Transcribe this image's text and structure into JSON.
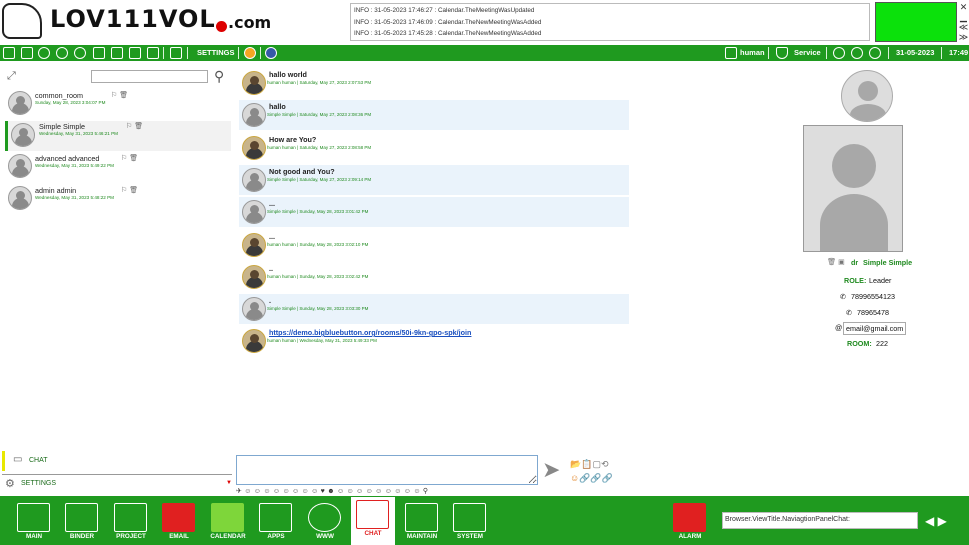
{
  "logo": {
    "text": "LOV111VOL",
    "domain": ".com"
  },
  "log": [
    "INFO : 31-05-2023 17:46:27 : Calendar.TheMeetingWasUpdated",
    "INFO : 31-05-2023 17:46:09 : Calendar.TheNewMeetingWasAdded",
    "INFO : 31-05-2023 17:45:28 : Calendar.TheNewMeetingWasAdded"
  ],
  "toolbar": {
    "settings": "SETTINGS",
    "user": "human",
    "service": "Service",
    "date": "31-05-2023",
    "time": "17:49"
  },
  "rooms": [
    {
      "name": "common_room",
      "date": "Sunday, May 28, 2023 3:04:07 PM"
    },
    {
      "name": "Simple Simple",
      "date": "Wednesday, May 31, 2023 5:46:21 PM"
    },
    {
      "name": "advanced advanced",
      "date": "Wednesday, May 31, 2023 5:49:22 PM"
    },
    {
      "name": "admin admin",
      "date": "Wednesday, May 31, 2023 5:48:22 PM"
    }
  ],
  "leftnav": {
    "chat": "CHAT",
    "settings": "SETTINGS"
  },
  "messages": [
    {
      "text": "hallo world",
      "meta": "human human | Saturday, May 27, 2023 2:07:53 PM",
      "photo": true
    },
    {
      "text": "hallo",
      "meta": "Simple Simple | Saturday, May 27, 2023 2:08:36 PM",
      "photo": false
    },
    {
      "text": "How are You?",
      "meta": "human human | Saturday, May 27, 2023 2:08:58 PM",
      "photo": true
    },
    {
      "text": "Not good and You?",
      "meta": "Simple Simple | Saturday, May 27, 2023 2:09:14 PM",
      "photo": false
    },
    {
      "text": "...",
      "meta": "Simple Simple | Sunday, May 28, 2023 3:01:42 PM",
      "photo": false
    },
    {
      "text": "...",
      "meta": "human human | Sunday, May 28, 2023 3:02:10 PM",
      "photo": true
    },
    {
      "text": "..",
      "meta": "human human | Sunday, May 28, 2023 3:02:42 PM",
      "photo": true
    },
    {
      "text": ".",
      "meta": "Simple Simple | Sunday, May 28, 2023 3:03:30 PM",
      "photo": false
    },
    {
      "text": "https://demo.bigbluebutton.org/rooms/50i-9kn-gpo-spk/join",
      "meta": "human human | Wednesday, May 31, 2023 5:49:33 PM",
      "photo": true,
      "link": true
    }
  ],
  "profile": {
    "title": "dr",
    "name": "Simple Simple",
    "role_label": "ROLE:",
    "role": "Leader",
    "phone1": "78996554123",
    "phone2": "78965478",
    "email": "email@gmail.com",
    "room_label": "ROOM:",
    "room": "222"
  },
  "emojis": "✈☺☺☺☺☺☺☺☺♥☻☺☺☺☺☺☺☺☺☺⚲",
  "bottomnav": [
    "MAIN",
    "BINDER",
    "PROJECT",
    "EMAIL",
    "CALENDAR",
    "APPS",
    "WWW",
    "CHAT",
    "MAINTAIN",
    "SYSTEM"
  ],
  "alarm": "ALARM",
  "navpanel": "Browser.ViewTitle.NaviagtionPanelChat:"
}
